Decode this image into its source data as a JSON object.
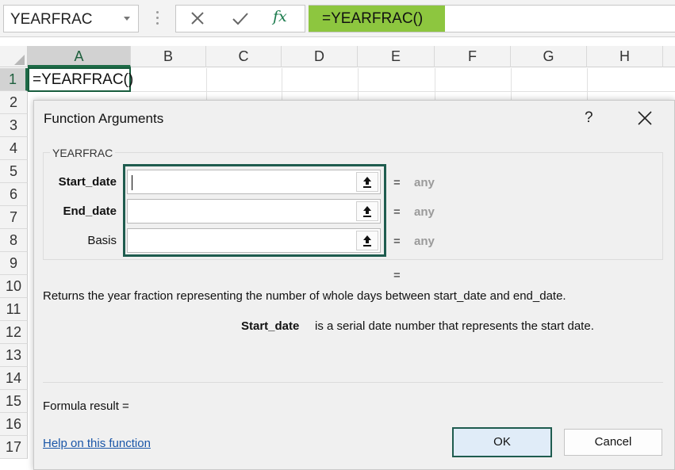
{
  "formula_bar": {
    "name_box": "YEARFRAC",
    "cancel_icon": "close-icon",
    "enter_icon": "checkmark-icon",
    "fx_label": "fx",
    "formula": "=YEARFRAC()",
    "highlight_color": "#8dc63f"
  },
  "grid": {
    "columns": [
      "A",
      "B",
      "C",
      "D",
      "E",
      "F",
      "G",
      "H"
    ],
    "rows": [
      "1",
      "2",
      "3",
      "4",
      "5",
      "6",
      "7",
      "8",
      "9",
      "10",
      "11",
      "12",
      "13",
      "14",
      "15",
      "16",
      "17"
    ],
    "active_cell": "A1",
    "active_cell_value": "=YEARFRAC()",
    "accent_color": "#1e6b47"
  },
  "dialog": {
    "title": "Function Arguments",
    "help_glyph": "?",
    "group_label": "YEARFRAC",
    "args": [
      {
        "label": "Start_date",
        "bold": true,
        "value": "",
        "equals": "=",
        "result": "any"
      },
      {
        "label": "End_date",
        "bold": true,
        "value": "",
        "equals": "=",
        "result": "any"
      },
      {
        "label": "Basis",
        "bold": false,
        "value": "",
        "equals": "=",
        "result": "any"
      }
    ],
    "overall_equals": "=",
    "description": "Returns the year fraction representing the number of whole days between start_date and end_date.",
    "arg_help_name": "Start_date",
    "arg_help_text": "is a serial date number that represents the start date.",
    "formula_result_label": "Formula result =",
    "help_link": "Help on this function",
    "ok_label": "OK",
    "cancel_label": "Cancel",
    "highlight_border_color": "#1f5c4f"
  }
}
